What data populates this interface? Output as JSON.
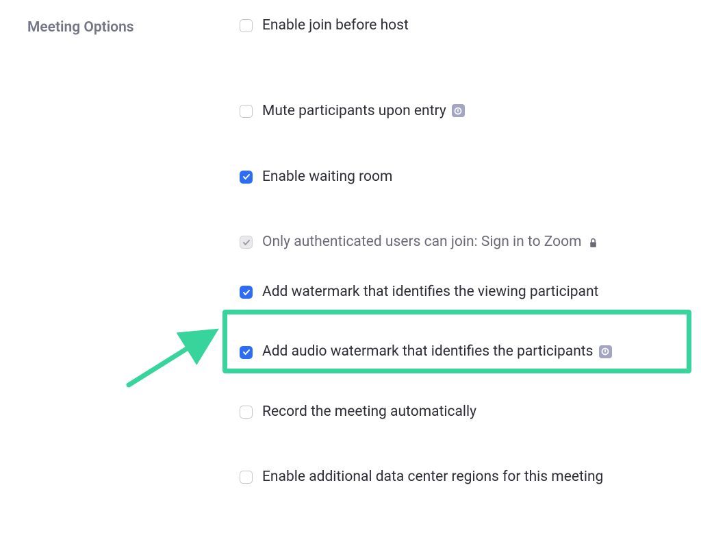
{
  "section_label": "Meeting Options",
  "options": {
    "join_before_host": "Enable join before host",
    "mute_on_entry": "Mute participants upon entry",
    "waiting_room": "Enable waiting room",
    "authenticated_only": "Only authenticated users can join: Sign in to Zoom",
    "video_watermark": "Add watermark that identifies the viewing participant",
    "audio_watermark": "Add audio watermark that identifies the participants",
    "auto_record": "Record the meeting automatically",
    "data_center": "Enable additional data center regions for this meeting"
  }
}
